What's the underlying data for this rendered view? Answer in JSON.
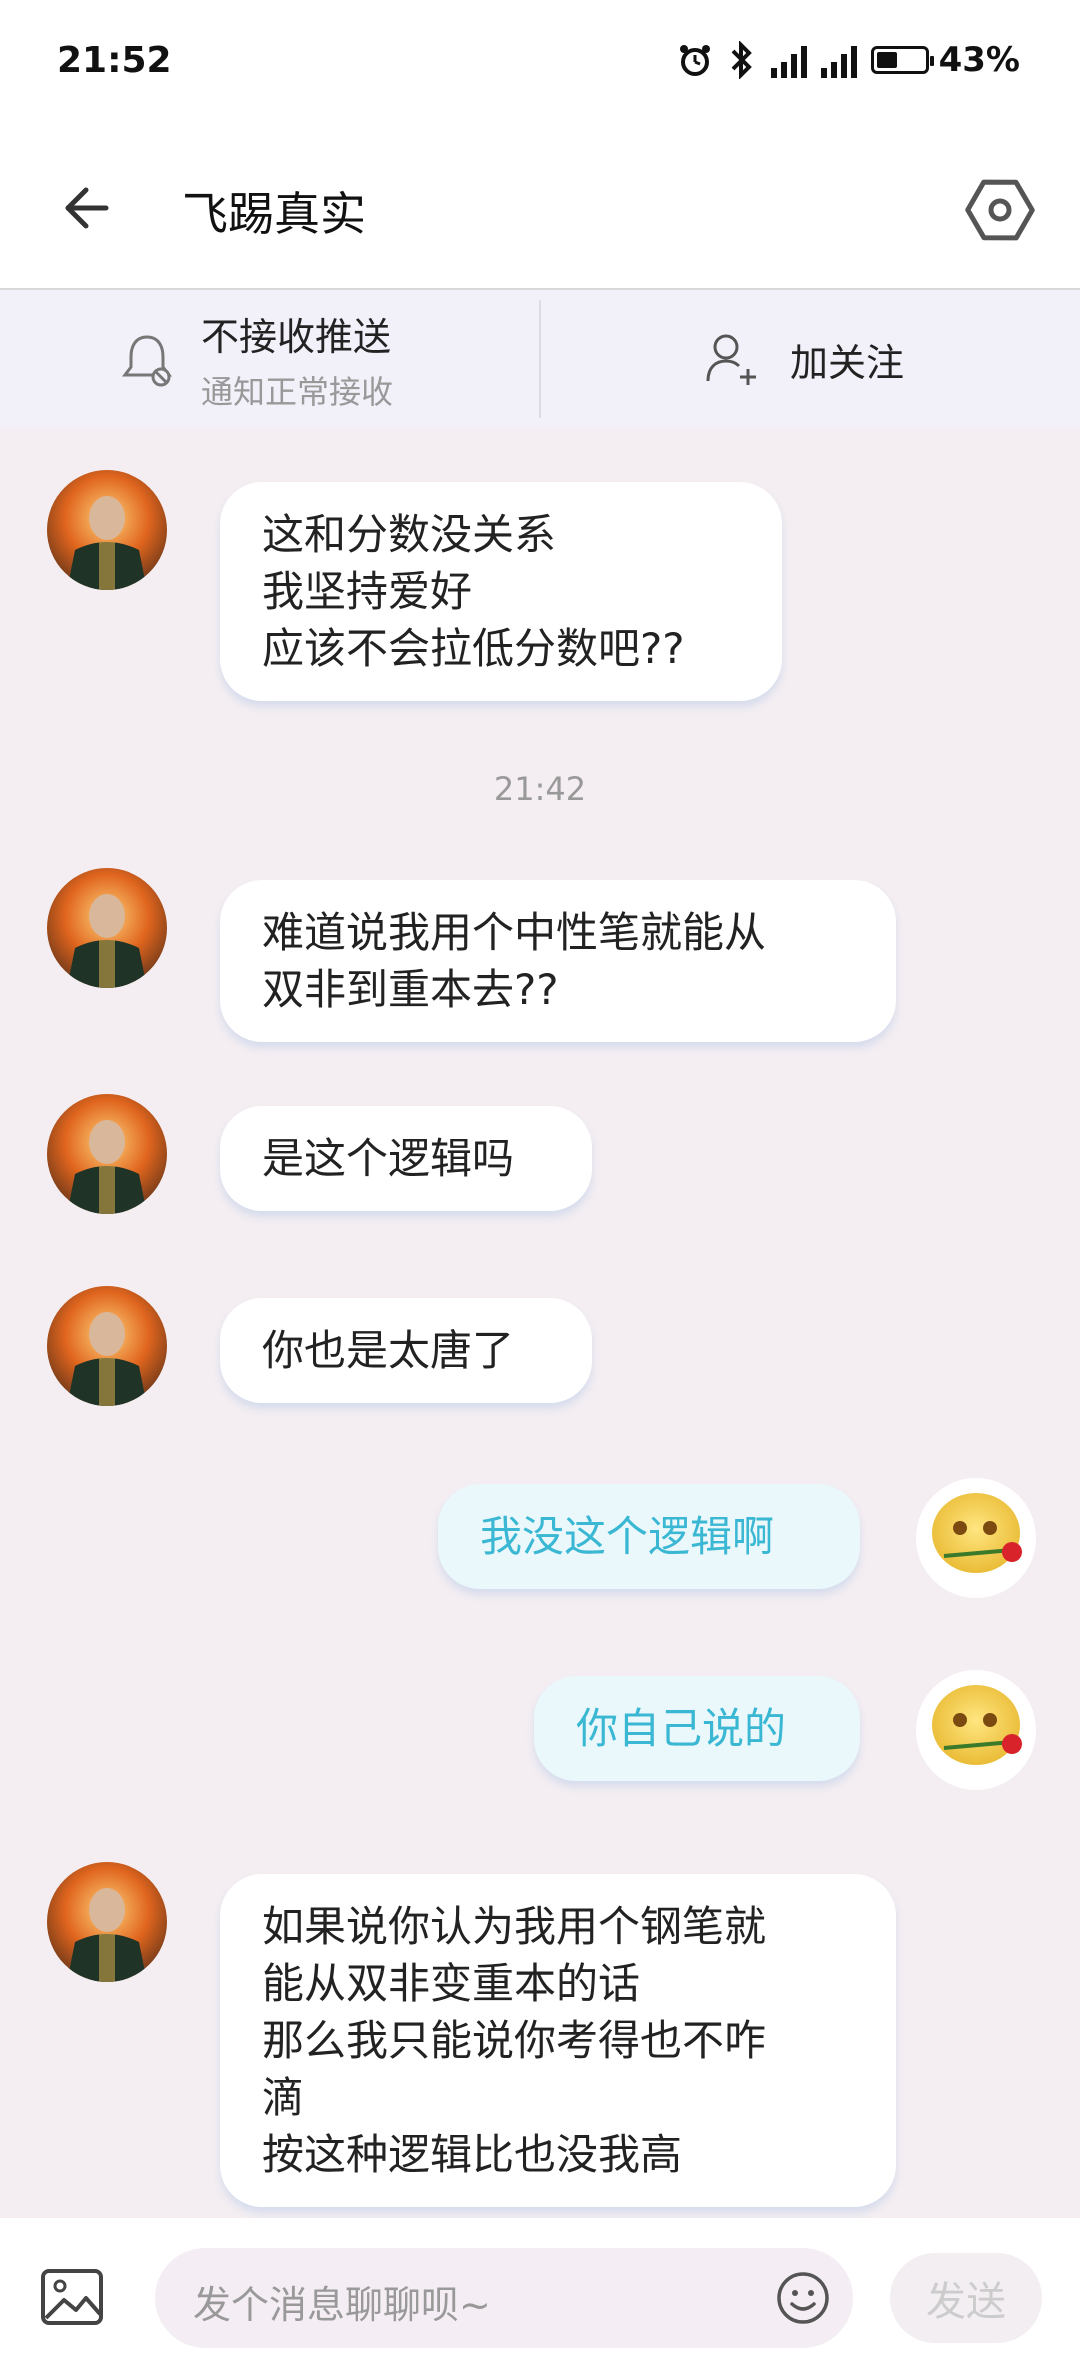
{
  "status_bar": {
    "time": "21:52",
    "battery": "43%",
    "network": "5G"
  },
  "header": {
    "title": "飞踢真实",
    "back_icon": "back-arrow-icon",
    "settings_icon": "settings-hex-icon"
  },
  "action_bar": {
    "push": {
      "label": "不接收推送",
      "sub": "通知正常接收",
      "icon": "bell-off-icon"
    },
    "follow": {
      "label": "加关注",
      "icon": "add-user-icon"
    }
  },
  "messages": [
    {
      "from": "other",
      "text": "这和分数没关系\n我坚持爱好\n应该不会拉低分数吧??"
    },
    {
      "from": "other",
      "text": "难道说我用个中性笔就能从\n双非到重本去??"
    },
    {
      "from": "other",
      "text": "是这个逻辑吗"
    },
    {
      "from": "other",
      "text": "你也是太唐了"
    },
    {
      "from": "me",
      "text": "我没这个逻辑啊"
    },
    {
      "from": "me",
      "text": "你自己说的"
    },
    {
      "from": "other",
      "text": "如果说你认为我用个钢笔就\n能从双非变重本的话\n那么我只能说你考得也不咋\n滴\n按这种逻辑比也没我高"
    }
  ],
  "timestamp": "21:42",
  "input": {
    "placeholder": "发个消息聊聊呗~",
    "send_label": "发送"
  },
  "colors": {
    "my_bubble_text": "#3ab7d3",
    "my_bubble_bg": "#eaf8fb",
    "chat_bg": "#f4eef2"
  }
}
